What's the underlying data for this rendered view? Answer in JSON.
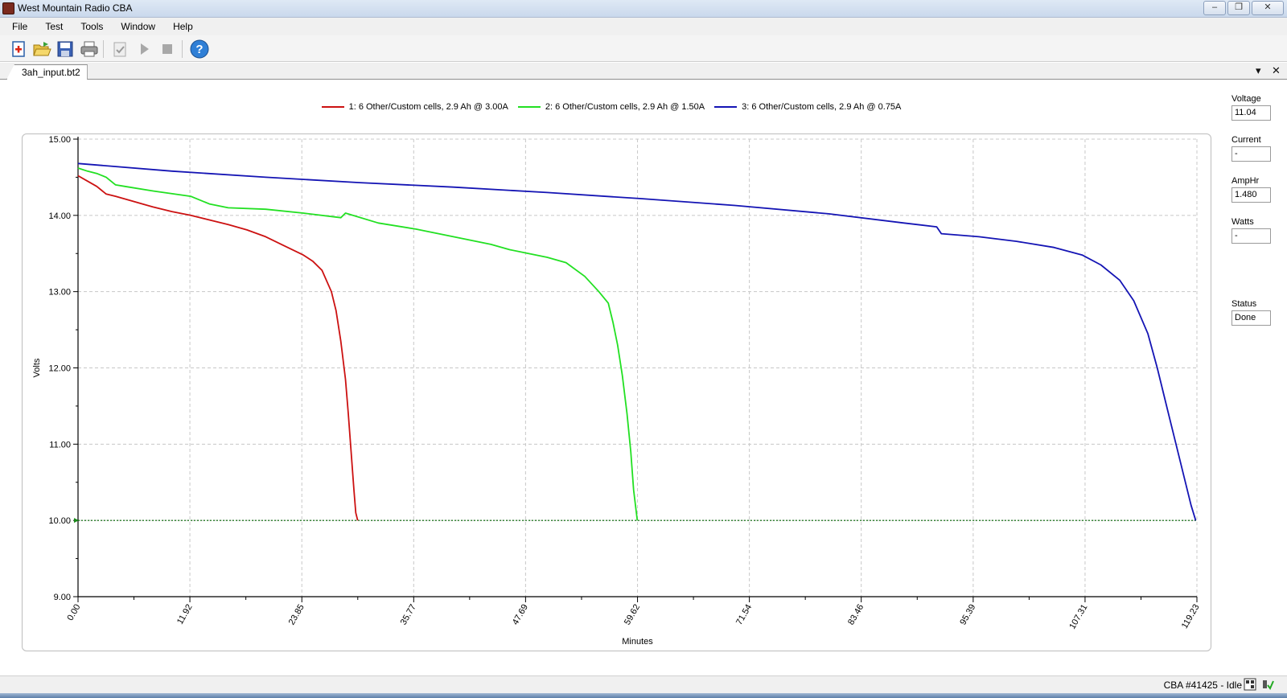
{
  "window": {
    "title": "West Mountain Radio CBA",
    "minimize_glyph": "–",
    "restore_glyph": "❐",
    "close_glyph": "✕"
  },
  "menu": {
    "items": [
      "File",
      "Test",
      "Tools",
      "Window",
      "Help"
    ]
  },
  "toolbar": {
    "icons": [
      "new-test-icon",
      "open-folder-icon",
      "save-icon",
      "print-icon",
      "checklist-icon",
      "play-icon",
      "stop-icon",
      "help-icon"
    ]
  },
  "tab": {
    "label": "3ah_input.bt2",
    "dropdown_glyph": "▾",
    "close_glyph": "✕"
  },
  "side_panel": {
    "voltage_label": "Voltage",
    "voltage_value": "11.04",
    "current_label": "Current",
    "current_value": "-",
    "amphr_label": "AmpHr",
    "amphr_value": "1.480",
    "watts_label": "Watts",
    "watts_value": "-",
    "status_label": "Status",
    "status_value": "Done"
  },
  "statusbar": {
    "text": "CBA #41425 - Idle"
  },
  "colors": {
    "series1": "#cc1111",
    "series2": "#22e022",
    "series3": "#1414b4",
    "cutoff": "#006400",
    "grid": "#c8c8c8"
  },
  "chart_data": {
    "type": "line",
    "xlabel": "Minutes",
    "ylabel": "Volts",
    "xlim": [
      0,
      119.23
    ],
    "ylim": [
      9,
      15
    ],
    "x_ticks": [
      "0.00",
      "11.92",
      "23.85",
      "35.77",
      "47.69",
      "59.62",
      "71.54",
      "83.46",
      "95.39",
      "107.31",
      "119.23"
    ],
    "y_ticks": [
      "15.00",
      "14.00",
      "13.00",
      "12.00",
      "11.00",
      "10.00",
      "9.00"
    ],
    "grid": true,
    "legend_position": "top",
    "cutoff_voltage": 10.0,
    "series": [
      {
        "name": "1: 6 Other/Custom cells, 2.9 Ah @ 3.00A",
        "x": [
          0,
          1,
          2,
          3,
          4,
          6,
          8,
          10,
          12,
          14,
          16,
          18,
          20,
          22,
          24,
          25,
          26,
          27,
          27.5,
          28,
          28.5,
          28.8,
          29.1,
          29.4,
          29.6,
          29.8
        ],
        "y": [
          14.52,
          14.45,
          14.38,
          14.28,
          14.25,
          14.18,
          14.11,
          14.05,
          14.0,
          13.94,
          13.88,
          13.81,
          13.72,
          13.6,
          13.48,
          13.4,
          13.28,
          13.0,
          12.75,
          12.35,
          11.85,
          11.4,
          10.9,
          10.4,
          10.1,
          10.0
        ]
      },
      {
        "name": "2: 6 Other/Custom cells, 2.9 Ah @ 1.50A",
        "x": [
          0,
          1,
          2,
          3,
          4,
          5,
          8,
          12,
          14,
          16,
          20,
          24,
          28,
          28.5,
          32,
          36,
          40,
          44,
          46,
          48,
          50,
          52,
          54,
          55.5,
          56.5,
          57,
          57.5,
          58,
          58.5,
          58.9,
          59.2,
          59.6
        ],
        "y": [
          14.62,
          14.58,
          14.55,
          14.5,
          14.4,
          14.38,
          14.32,
          14.25,
          14.15,
          14.1,
          14.08,
          14.03,
          13.97,
          14.03,
          13.9,
          13.82,
          13.72,
          13.62,
          13.55,
          13.5,
          13.45,
          13.38,
          13.2,
          13.0,
          12.85,
          12.6,
          12.3,
          11.9,
          11.4,
          10.9,
          10.4,
          10.0
        ]
      },
      {
        "name": "3: 6 Other/Custom cells, 2.9 Ah @ 0.75A",
        "x": [
          0,
          10,
          20,
          30,
          40,
          50,
          60,
          70,
          80,
          88,
          91.5,
          92,
          96,
          100,
          104,
          107,
          109,
          111,
          112.5,
          114,
          115,
          116,
          117,
          118,
          118.6,
          119.1
        ],
        "y": [
          14.68,
          14.58,
          14.5,
          14.43,
          14.37,
          14.3,
          14.22,
          14.13,
          14.02,
          13.9,
          13.85,
          13.76,
          13.72,
          13.66,
          13.58,
          13.48,
          13.35,
          13.15,
          12.88,
          12.45,
          12.0,
          11.5,
          11.0,
          10.5,
          10.2,
          10.0
        ]
      }
    ]
  }
}
